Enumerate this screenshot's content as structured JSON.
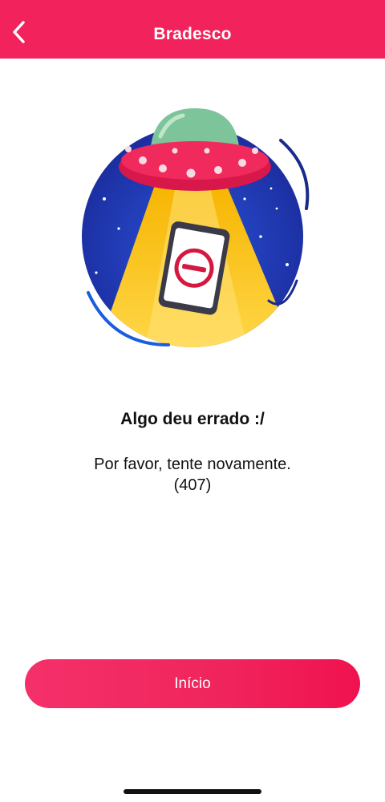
{
  "header": {
    "title": "Bradesco",
    "back_icon": "chevron-left-icon",
    "color": "#f2225c"
  },
  "illustration": {
    "name": "ufo-abducting-phone",
    "phone_icon": "no-entry-icon"
  },
  "error": {
    "heading": "Algo deu errado :/",
    "message": "Por favor, tente novamente.",
    "code": "(407)"
  },
  "actions": {
    "start_label": "Início",
    "start_color": "#f0245c"
  }
}
